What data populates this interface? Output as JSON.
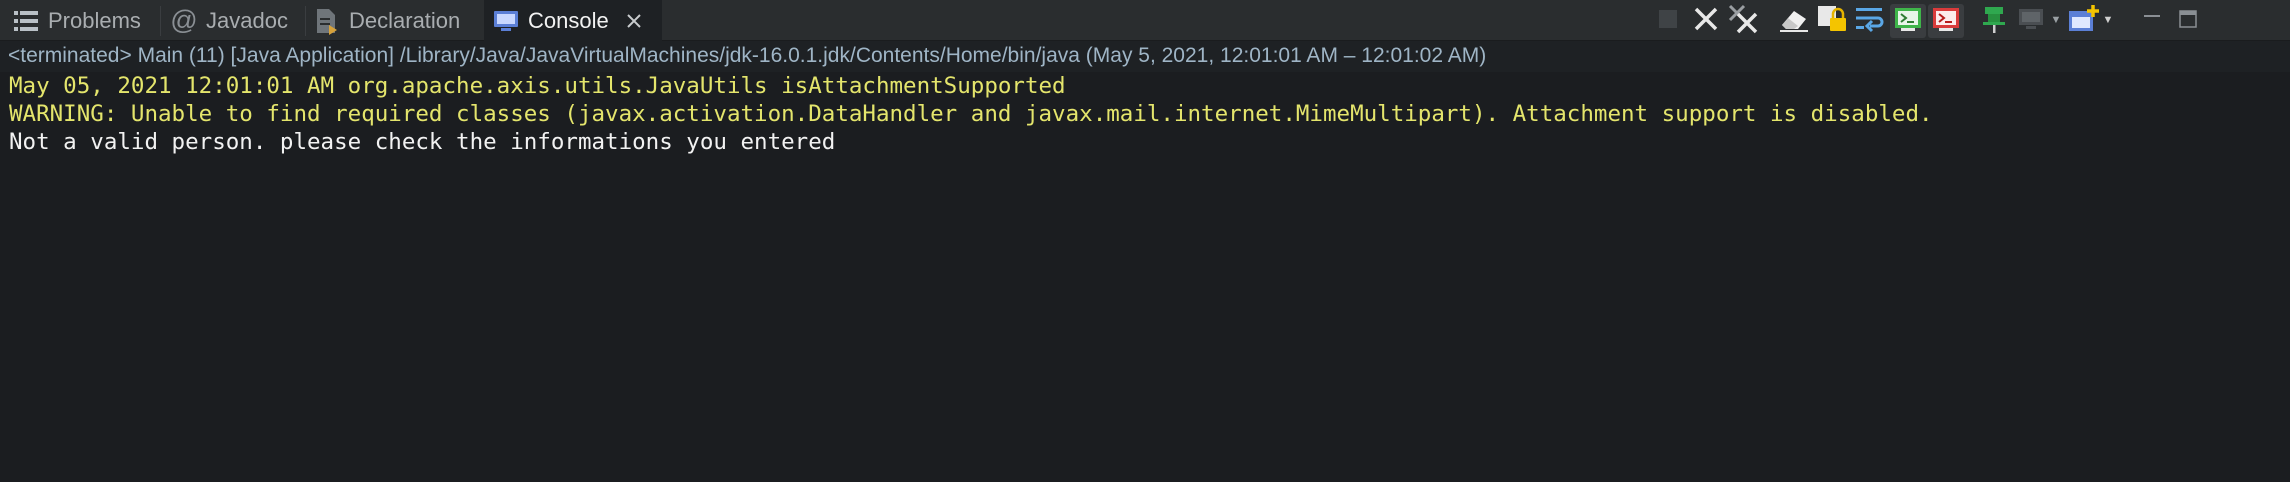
{
  "tabs": [
    {
      "label": "Problems",
      "icon": "problems-icon",
      "active": false
    },
    {
      "label": "Javadoc",
      "icon": "javadoc-icon",
      "active": false
    },
    {
      "label": "Declaration",
      "icon": "declaration-icon",
      "active": false
    },
    {
      "label": "Console",
      "icon": "console-icon",
      "active": true
    }
  ],
  "toolbar": {
    "icons": [
      "terminate-icon",
      "remove-launch-icon",
      "remove-all-terminated-icon",
      "clear-console-icon",
      "scroll-lock-icon",
      "word-wrap-icon",
      "show-on-stdout-icon",
      "show-on-stderr-icon",
      "pin-console-icon",
      "display-selected-console-icon",
      "open-console-icon",
      "minimize-icon",
      "maximize-icon"
    ]
  },
  "console": {
    "status": "<terminated> Main (11) [Java Application] /Library/Java/JavaVirtualMachines/jdk-16.0.1.jdk/Contents/Home/bin/java  (May 5, 2021, 12:01:01 AM – 12:01:02 AM)",
    "lines": [
      {
        "text": "May 05, 2021 12:01:01 AM org.apache.axis.utils.JavaUtils isAttachmentSupported",
        "stream": "stderr"
      },
      {
        "text": "WARNING: Unable to find required classes (javax.activation.DataHandler and javax.mail.internet.MimeMultipart). Attachment support is disabled.",
        "stream": "stderr"
      },
      {
        "text": "Not a valid person. please check the informations you entered",
        "stream": "stdout"
      }
    ]
  },
  "colors": {
    "stderr": "#e4e56c",
    "stdout": "#f2f2f2",
    "status": "#9fb5c6",
    "background": "#1b1d20"
  }
}
